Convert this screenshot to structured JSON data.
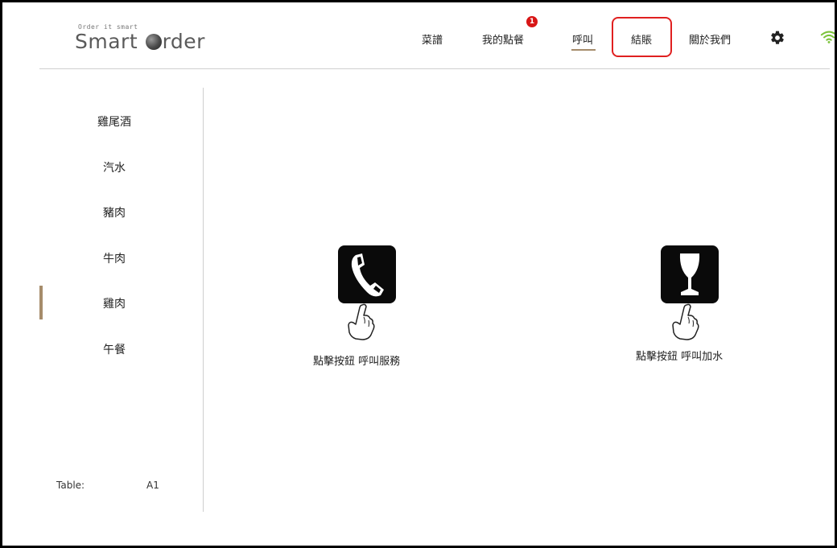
{
  "logo": {
    "tagline": "Order it smart",
    "name_before": "Smart ",
    "name_after": "rder"
  },
  "nav": {
    "menu": "菜譜",
    "my_order": "我的點餐",
    "my_order_badge": "1",
    "call": "呼叫",
    "checkout": "結賬",
    "about": "關於我們",
    "settings_icon": "gear-icon",
    "wifi_icon": "wifi-icon",
    "active_item": "呼叫",
    "highlighted_item": "結賬"
  },
  "sidebar": {
    "items": [
      {
        "label": "雞尾酒"
      },
      {
        "label": "汽水"
      },
      {
        "label": "豬肉"
      },
      {
        "label": "牛肉"
      },
      {
        "label": "雞肉"
      },
      {
        "label": "午餐"
      }
    ],
    "selected_label": "雞肉",
    "table_label": "Table:",
    "table_value": "A1"
  },
  "main": {
    "call_service": {
      "icon": "phone-icon",
      "label": "點擊按鈕 呼叫服務"
    },
    "call_water": {
      "icon": "wine-glass-icon",
      "label": "點擊按鈕 呼叫加水"
    }
  },
  "colors": {
    "accent": "#a68c6b",
    "badge": "#d81616",
    "highlight": "#e02020",
    "wifi": "#7cc33a",
    "icon_bg": "#0a0a0a"
  }
}
